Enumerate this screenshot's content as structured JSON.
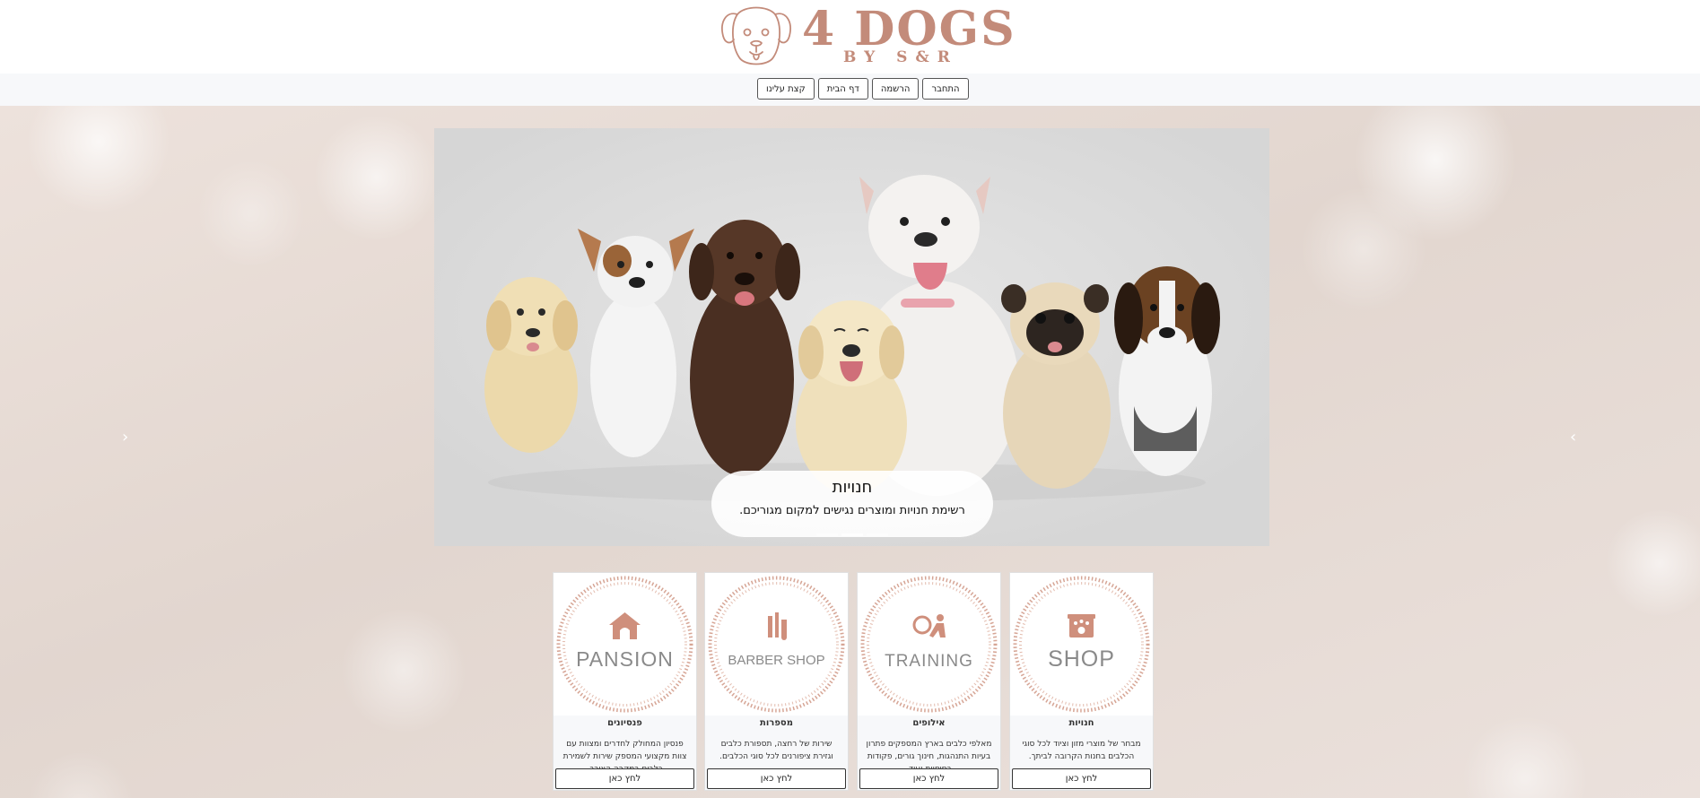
{
  "logo": {
    "title": "4 DOGS",
    "subtitle": "BY S&R"
  },
  "nav": {
    "buttons": [
      "התחבר",
      "הרשמה",
      "דף הבית",
      "קצת עלינו"
    ]
  },
  "carousel": {
    "caption_title": "חנויות",
    "caption_text": "רשימת חנויות ומוצרים נגישים למקום מגוריכם.",
    "prev_icon": "chevron-left-icon",
    "next_icon": "chevron-right-icon"
  },
  "cards": [
    {
      "logo": "SHOP",
      "icon": "storefront-paw-icon",
      "title": "חנויות",
      "text": "מבחר של מוצרי מזון וציוד לכל סוגי הכלבים בחנות הקרובה לביתך.",
      "button": "לחץ כאן"
    },
    {
      "logo": "TRAINING",
      "icon": "dog-trainer-icon",
      "title": "אילופים",
      "text": "מאלפי כלבים בארץ המספקים פתרון בעיות התנהגות, חינוך גורים, פקודות בסיסיות ועוד.",
      "button": "לחץ כאן"
    },
    {
      "logo": "BARBER SHOP",
      "icon": "grooming-tools-icon",
      "title": "מספרות",
      "text": "שירות של רחצה, תספורת כלבים וגזירת ציפורנים לכל סוגי הכלבים.",
      "button": "לחץ כאן"
    },
    {
      "logo": "PANSION",
      "icon": "dog-house-icon",
      "title": "פנסיונים",
      "text": "פנסיון המחולק לחדרים ומצוות עם צוות מקצועי המספק שירות לשמירת כלבים במקרה הצורך.",
      "button": "לחץ כאן"
    }
  ],
  "colors": {
    "brand": "#c38b7a",
    "nav_bg": "#f7f8fa"
  }
}
